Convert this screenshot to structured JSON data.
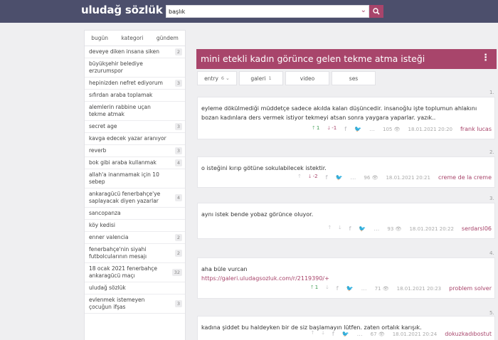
{
  "header": {
    "logo": "uludağ sözlük",
    "search": {
      "value": "başlık"
    }
  },
  "sidebar": {
    "tabs": [
      "bugün",
      "kategori",
      "gündem"
    ],
    "items": [
      {
        "title": "deveye diken insana siken",
        "count": "2"
      },
      {
        "title": "büyükşehir belediye erzurumspor",
        "count": ""
      },
      {
        "title": "hepinizden nefret ediyorum",
        "count": "3"
      },
      {
        "title": "sıfırdan araba toplamak",
        "count": ""
      },
      {
        "title": "alemlerin rabbine uçan tekme atmak",
        "count": ""
      },
      {
        "title": "secret age",
        "count": "3"
      },
      {
        "title": "kavga edecek yazar aranıyor",
        "count": ""
      },
      {
        "title": "reverb",
        "count": "3"
      },
      {
        "title": "bok gibi araba kullanmak",
        "count": "4"
      },
      {
        "title": "allah'a inanmamak için 10 sebep",
        "count": ""
      },
      {
        "title": "ankaragücü fenerbahçe'ye saplayacak diyen yazarlar",
        "count": "4"
      },
      {
        "title": "sancopanza",
        "count": ""
      },
      {
        "title": "köy kedisi",
        "count": ""
      },
      {
        "title": "enner valencia",
        "count": "2"
      },
      {
        "title": "fenerbahçe'nin siyahi futbolcularının mesajı",
        "count": "2"
      },
      {
        "title": "18 ocak 2021 fenerbahçe ankaragücü maçı",
        "count": "32"
      },
      {
        "title": "uludağ sözlük",
        "count": ""
      },
      {
        "title": "evlenmek istemeyen çocuğun ifşas",
        "count": "3"
      }
    ]
  },
  "topic": {
    "title": "mini etekli kadın görünce gelen tekme atma isteği",
    "tabs": [
      {
        "label": "entry",
        "count": "6",
        "chevron": "⌄"
      },
      {
        "label": "galeri",
        "count": "1"
      },
      {
        "label": "video",
        "count": ""
      },
      {
        "label": "ses",
        "count": ""
      }
    ]
  },
  "entries": [
    {
      "num": "1.",
      "text": "eyleme dökülmediği müddetçe sadece akılda kalan düşüncedir. insanoğlu işte toplumun ahlakını bozan kadınlara ders vermek istiyor tekmeyi atsan sonra yaygara yaparlar. yazık..",
      "link": "",
      "up": "1",
      "down": "-1",
      "views": "105",
      "date": "18.01.2021 20:20",
      "author": "frank lucas"
    },
    {
      "num": "2.",
      "text": "o isteğini kırıp götüne sokulabilecek istektir.",
      "link": "",
      "up": "",
      "down": "-2",
      "views": "96",
      "date": "18.01.2021 20:21",
      "author": "creme de la creme"
    },
    {
      "num": "3.",
      "text": "aynı istek bende yobaz görünce oluyor.",
      "link": "",
      "up": "",
      "down": "",
      "views": "93",
      "date": "18.01.2021 20:22",
      "author": "serdarsl06"
    },
    {
      "num": "4.",
      "text": "aha büle vurcan",
      "link": "https://galeri.uludagsozluk.com/r/2119390/+",
      "up": "1",
      "down": "",
      "views": "71",
      "date": "18.01.2021 20:23",
      "author": "problem solver"
    },
    {
      "num": "5.",
      "text": "kadına şiddet bu haldeyken bir de siz başlamayın lütfen. zaten ortalık karışık.",
      "link": "",
      "up": "",
      "down": "",
      "views": "67",
      "date": "18.01.2021 20:24",
      "author": "dokuzkadıbostut"
    }
  ],
  "icons": {
    "search": "search-icon",
    "kebab": "kebab-menu-icon",
    "eye": "eye-icon"
  },
  "colors": {
    "accent": "#a8456b",
    "header": "#4c4f6c",
    "upvote": "#3a9a4e"
  }
}
